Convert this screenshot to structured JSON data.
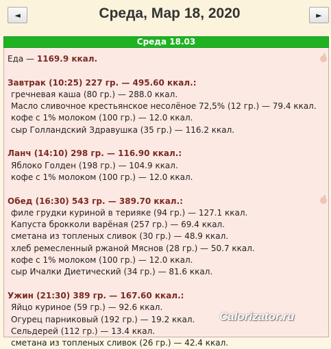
{
  "header": {
    "prev_glyph": "◄",
    "next_glyph": "►",
    "date_title": "Среда, Мар 18, 2020"
  },
  "panel": {
    "title": "Среда 18.03"
  },
  "total": {
    "label": "Еда — ",
    "value": "1169.9 ккал."
  },
  "meals": [
    {
      "title": "Завтрак (10:25) 227 гр. — 495.60 ккал.:",
      "items": [
        "гречневая каша (80 гр.) — 288.0 ккал.",
        "Масло сливочное крестьянское несолёное 72,5% (12 гр.) — 79.4 ккал.",
        "кофе с 1% молоком (100 гр.) — 12.0 ккал.",
        "сыр Голландский Здравушка (35 гр.) — 116.2 ккал."
      ]
    },
    {
      "title": "Ланч (14:10) 298 гр. — 116.90 ккал.:",
      "items": [
        "Яблоко Голден (198 гр.) — 104.9 ккал.",
        "кофе с 1% молоком (100 гр.) — 12.0 ккал."
      ]
    },
    {
      "title": "Обед (16:30) 543 гр. — 389.70 ккал.:",
      "items": [
        "филе грудки куриной в терияке (94 гр.) — 127.1 ккал.",
        "Капуста брокколи варёная (257 гр.) — 69.4 ккал.",
        "сметана из топленых сливок (30 гр.) — 48.9 ккал.",
        "хлеб ремесленный ржаной Мяснов (28 гр.) — 50.7 ккал.",
        "кофе с 1% молоком (100 гр.) — 12.0 ккал.",
        "сыр Ичалки Диетический (34 гр.) — 81.6 ккал."
      ]
    },
    {
      "title": "Ужин (21:30) 389 гр. — 167.60 ккал.:",
      "items": [
        "Яйцо куриное (59 гр.) — 92.6 ккал.",
        "Огурец парниковый (192 гр.) — 19.2 ккал.",
        "Сельдерей (112 гр.) — 13.4 ккал.",
        "сметана из топленых сливок (26 гр.) — 42.4 ккал."
      ]
    }
  ],
  "icons": {
    "apple_icon": "apple-icon"
  },
  "watermark": "Calorizator.ru"
}
